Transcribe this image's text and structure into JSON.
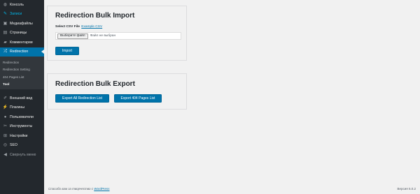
{
  "sidebar": {
    "items_top": [
      {
        "label": "Консоль",
        "icon": "dashboard-icon",
        "glyph": "◍"
      },
      {
        "label": "Записи",
        "icon": "pin-icon",
        "glyph": "✎",
        "highlight": true
      },
      {
        "label": "Медиафайлы",
        "icon": "media-icon",
        "glyph": "▣"
      },
      {
        "label": "Страницы",
        "icon": "pages-icon",
        "glyph": "▤"
      },
      {
        "label": "Комментарии",
        "icon": "comments-icon",
        "glyph": "▰"
      },
      {
        "label": "Redirection",
        "icon": "shuffle-icon",
        "glyph": "⤮",
        "active": true
      }
    ],
    "submenu": [
      "Redirection",
      "Redirection Setting",
      "404 Pages List",
      "Tool"
    ],
    "submenu_current": "Tool",
    "items_bottom": [
      {
        "label": "Внешний вид",
        "icon": "appearance-icon",
        "glyph": "✐"
      },
      {
        "label": "Плагины",
        "icon": "plugins-icon",
        "glyph": "⚡"
      },
      {
        "label": "Пользователи",
        "icon": "users-icon",
        "glyph": "●"
      },
      {
        "label": "Инструменты",
        "icon": "tools-icon",
        "glyph": "✂"
      },
      {
        "label": "Настройки",
        "icon": "settings-icon",
        "glyph": "⊞"
      },
      {
        "label": "SEO",
        "icon": "seo-icon",
        "glyph": "◎"
      },
      {
        "label": "Свернуть меню",
        "icon": "collapse-icon",
        "glyph": "◀",
        "collapse": true
      }
    ]
  },
  "import_panel": {
    "title": "Redirection Bulk Import",
    "field_label": "Select CSV File",
    "example_link": "Example CSV",
    "file_button": "Выберите файл",
    "file_status": "Файл не выбран",
    "import_button": "Import"
  },
  "export_panel": {
    "title": "Redirection Bulk Export",
    "export_all_button": "Export All Redirection List",
    "export_404_button": "Export 404 Pages List"
  },
  "footer": {
    "thanks_text": "Спасибо вам за творчество с",
    "wordpress_link": "WordPress",
    "version": "Версия 5.0.2"
  },
  "colors": {
    "accent": "#0073aa",
    "sidebar_bg": "#23282d"
  }
}
